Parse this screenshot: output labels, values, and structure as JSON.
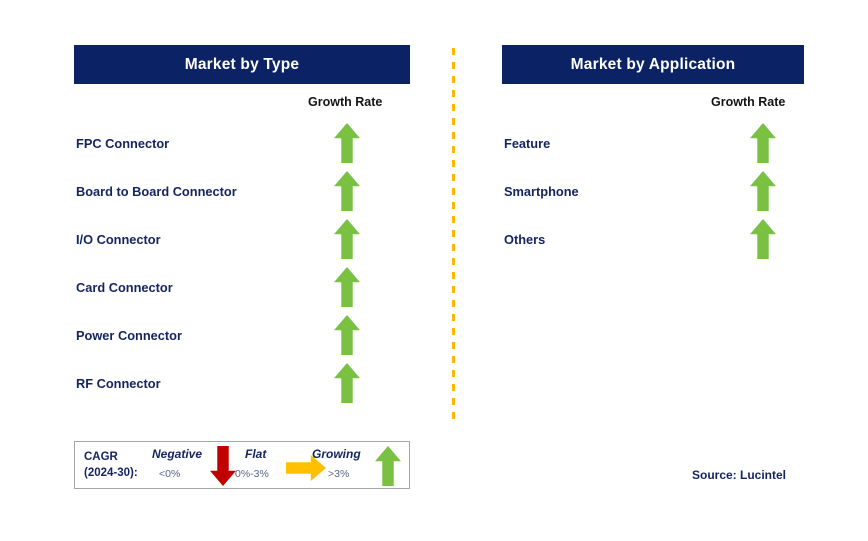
{
  "panels": [
    {
      "title": "Market by Type",
      "growth_rate_header": "Growth Rate",
      "items": [
        {
          "label": "FPC Connector",
          "trend": "growing",
          "icon": "arrow-up-icon"
        },
        {
          "label": "Board to Board Connector",
          "trend": "growing",
          "icon": "arrow-up-icon"
        },
        {
          "label": " I/O Connector",
          "trend": "growing",
          "icon": "arrow-up-icon"
        },
        {
          "label": "Card Connector",
          "trend": "growing",
          "icon": "arrow-up-icon"
        },
        {
          "label": "Power Connector",
          "trend": "growing",
          "icon": "arrow-up-icon"
        },
        {
          "label": "RF Connector",
          "trend": "growing",
          "icon": "arrow-up-icon"
        }
      ]
    },
    {
      "title": "Market by Application",
      "growth_rate_header": "Growth Rate",
      "items": [
        {
          "label": "Feature",
          "trend": "growing",
          "icon": "arrow-up-icon"
        },
        {
          "label": "Smartphone",
          "trend": "growing",
          "icon": "arrow-up-icon"
        },
        {
          "label": "Others",
          "trend": "growing",
          "icon": "arrow-up-icon"
        }
      ]
    }
  ],
  "legend": {
    "cagr_line1": "CAGR",
    "cagr_line2": "(2024-30):",
    "entries": [
      {
        "title": "Negative",
        "value": "<0%",
        "icon": "arrow-down-icon",
        "color": "#c00000"
      },
      {
        "title": "Flat",
        "value": "0%-3%",
        "icon": "arrow-right-icon",
        "color": "#ffc000"
      },
      {
        "title": "Growing",
        "value": ">3%",
        "icon": "arrow-up-icon",
        "color": "#7ac143"
      }
    ]
  },
  "source": "Source: Lucintel",
  "colors": {
    "header_bg": "#0b2265",
    "label_navy": "#14245f",
    "growing_green": "#7ac143",
    "negative_red": "#c00000",
    "flat_yellow": "#ffc000",
    "divider_amber": "#ffb600",
    "legend_border": "#a6a6a6"
  }
}
